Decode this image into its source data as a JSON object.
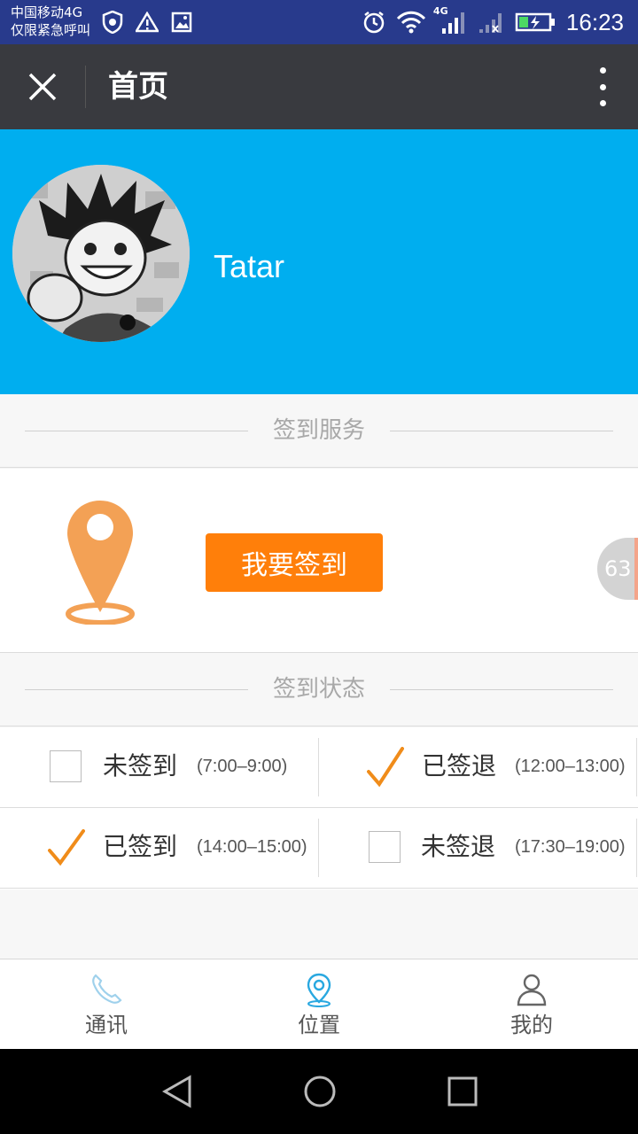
{
  "status_bar": {
    "carrier_line1": "中国移动4G",
    "carrier_line2": "仅限紧急呼叫",
    "network_label": "4G",
    "time": "16:23"
  },
  "title_bar": {
    "title": "首页",
    "close_icon": "close-icon",
    "more_icon": "more-vertical-icon"
  },
  "profile": {
    "username": "Tatar"
  },
  "sections": {
    "checkin_service": "签到服务",
    "checkin_status": "签到状态"
  },
  "checkin": {
    "button_label": "我要签到",
    "badge": "63",
    "pin_color": "#f3a155",
    "button_color": "#ff7f0a"
  },
  "status": {
    "rows": [
      [
        {
          "checked": false,
          "label": "未签到",
          "time": "(7:00–9:00)"
        },
        {
          "checked": true,
          "label": "已签退",
          "time": "(12:00–13:00)"
        }
      ],
      [
        {
          "checked": true,
          "label": "已签到",
          "time": "(14:00–15:00)"
        },
        {
          "checked": false,
          "label": "未签退",
          "time": "(17:30–19:00)"
        }
      ]
    ],
    "check_color": "#f08c1a"
  },
  "tabs": [
    {
      "label": "通讯",
      "icon": "phone-icon",
      "active": false
    },
    {
      "label": "位置",
      "icon": "location-icon",
      "active": true
    },
    {
      "label": "我的",
      "icon": "user-icon",
      "active": false
    }
  ],
  "colors": {
    "header_blue": "#00aeef",
    "title_bar": "#393a3f",
    "status_bar": "#283a8c",
    "active_tab": "#29a8e0"
  }
}
